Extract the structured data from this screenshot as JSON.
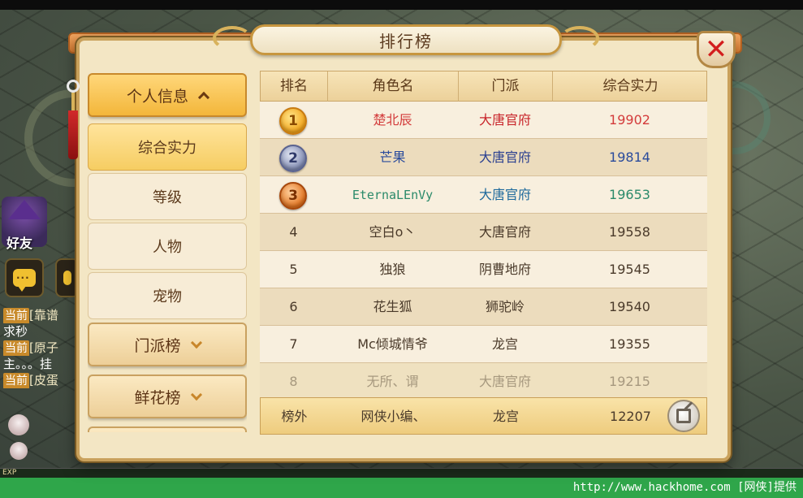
{
  "background": {
    "friend_label": "好友",
    "exp_label": "EXP",
    "watermark": "http://www.hackhome.com [网侠]提供",
    "chat": [
      {
        "tag": "当前",
        "name": "[靠谱",
        "text": ""
      },
      {
        "tag": "",
        "name": "",
        "text": "求秒"
      },
      {
        "tag": "当前",
        "name": "[原子",
        "text": ""
      },
      {
        "tag": "",
        "name": "",
        "text": "主。。。挂"
      },
      {
        "tag": "当前",
        "name": "[皮蛋",
        "text": ""
      }
    ]
  },
  "panel": {
    "title": "排行榜",
    "close_icon": "close-x-icon",
    "close_glyph": "✕"
  },
  "sidebar": {
    "groups": [
      {
        "label": "个人信息",
        "expanded": true
      },
      {
        "label": "门派榜",
        "expanded": false
      },
      {
        "label": "鲜花榜",
        "expanded": false
      }
    ],
    "items": [
      {
        "label": "综合实力",
        "selected": true
      },
      {
        "label": "等级",
        "selected": false
      },
      {
        "label": "人物",
        "selected": false
      },
      {
        "label": "宠物",
        "selected": false
      }
    ]
  },
  "table": {
    "headers": [
      "排名",
      "角色名",
      "门派",
      "综合实力"
    ],
    "rows": [
      {
        "rank": "1",
        "name": "楚北辰",
        "school": "大唐官府",
        "power": "19902",
        "medal": "gold"
      },
      {
        "rank": "2",
        "name": "芒果",
        "school": "大唐官府",
        "power": "19814",
        "medal": "silver"
      },
      {
        "rank": "3",
        "name": "EternaLEnVy",
        "school": "大唐官府",
        "power": "19653",
        "medal": "bronze"
      },
      {
        "rank": "4",
        "name": "空白o丶",
        "school": "大唐官府",
        "power": "19558"
      },
      {
        "rank": "5",
        "name": "独狼",
        "school": "阴曹地府",
        "power": "19545"
      },
      {
        "rank": "6",
        "name": "花生狐",
        "school": "狮驼岭",
        "power": "19540"
      },
      {
        "rank": "7",
        "name": "Mc倾城情爷",
        "school": "龙宫",
        "power": "19355"
      },
      {
        "rank": "8",
        "name": "无所、谓",
        "school": "大唐官府",
        "power": "19215"
      }
    ],
    "self_row": {
      "rank": "榜外",
      "name": "网侠小编、",
      "school": "龙宫",
      "power": "12207"
    },
    "share_icon": "share-icon"
  },
  "colors": {
    "panel_bg": "#f3e6c4",
    "accent_gold": "#f3b63a",
    "rank1": "#d33b3b",
    "rank2": "#2a4b9c",
    "rank3": "#2b8a6a",
    "close_red": "#d31e1e"
  }
}
